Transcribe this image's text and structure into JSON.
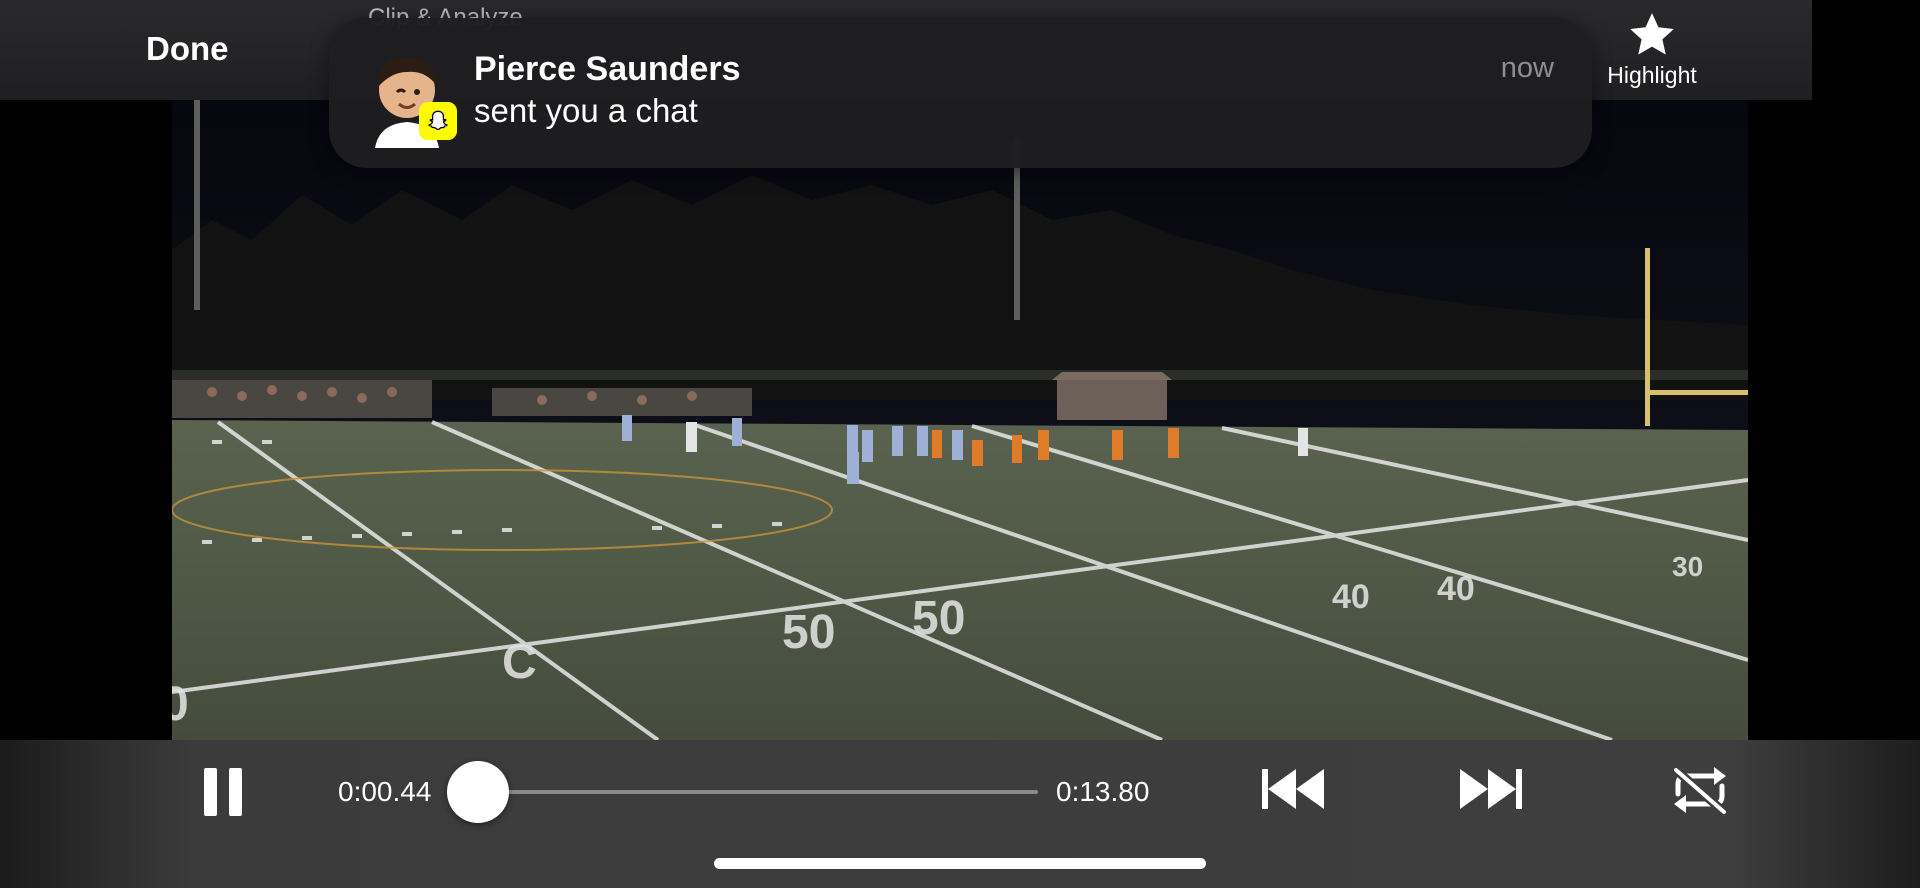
{
  "header": {
    "background_title": "Clip & Analyze",
    "done_label": "Done",
    "highlight_label": "Highlight",
    "highlight_icon": "star-icon"
  },
  "notification": {
    "app_icon": "snapchat-ghost-icon",
    "avatar": "bitmoji-avatar",
    "sender": "Pierce Saunders",
    "message": "sent you a chat",
    "time": "now",
    "badge_color": "#FFFC00"
  },
  "video": {
    "scene": "night-football-field",
    "yard_markers": [
      "0",
      "C",
      "50",
      "50",
      "40",
      "40",
      "30"
    ]
  },
  "player": {
    "current_time": "0:00.44",
    "duration": "0:13.80",
    "progress": 0.032,
    "accent_color": "#ff6a2c",
    "pause_icon": "pause-icon",
    "skip_back_icon": "skip-back-icon",
    "skip_forward_icon": "skip-forward-icon",
    "loop_icon": "loop-off-icon"
  }
}
